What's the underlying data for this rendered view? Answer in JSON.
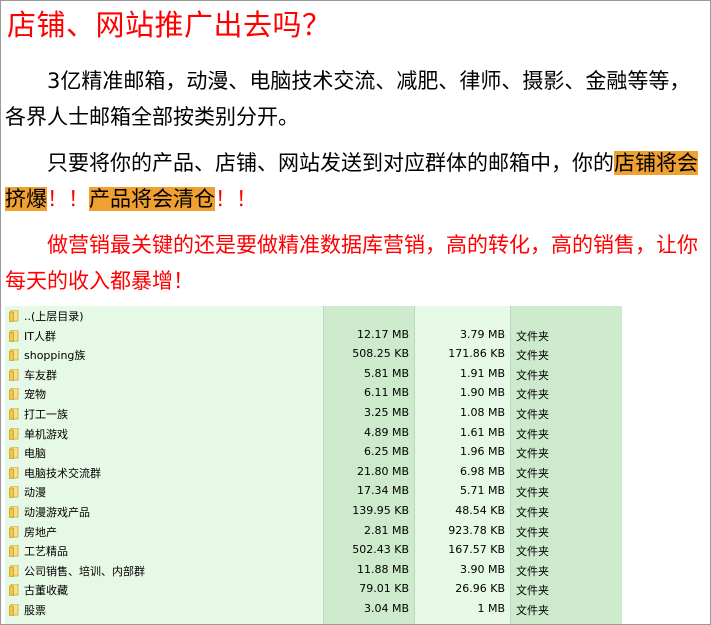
{
  "title": "店铺、网站推广出去吗？",
  "paragraph1": "3亿精准邮箱，动漫、电脑技术交流、减肥、律师、摄影、金融等等，各界人士邮箱全部按类别分开。",
  "paragraph2": {
    "lead": "只要将你的产品、店铺、网站发送到对应群体的邮箱中，你的",
    "hl1": "店铺将会挤爆",
    "mid": "！！",
    "hl2": "产品将会清仓",
    "tail": "！！"
  },
  "paragraph3": "做营销最关键的还是要做精准数据库营销，高的转化，高的销售，让你每天的收入都暴增！",
  "listing": {
    "parent": {
      "name": "..(上层目录)"
    },
    "rows": [
      {
        "name": "IT人群",
        "size": "12.17 MB",
        "compressed": "3.79 MB",
        "type": "文件夹"
      },
      {
        "name": "shopping族",
        "size": "508.25 KB",
        "compressed": "171.86 KB",
        "type": "文件夹"
      },
      {
        "name": "车友群",
        "size": "5.81 MB",
        "compressed": "1.91 MB",
        "type": "文件夹"
      },
      {
        "name": "宠物",
        "size": "6.11 MB",
        "compressed": "1.90 MB",
        "type": "文件夹"
      },
      {
        "name": "打工一族",
        "size": "3.25 MB",
        "compressed": "1.08 MB",
        "type": "文件夹"
      },
      {
        "name": "单机游戏",
        "size": "4.89 MB",
        "compressed": "1.61 MB",
        "type": "文件夹"
      },
      {
        "name": "电脑",
        "size": "6.25 MB",
        "compressed": "1.96 MB",
        "type": "文件夹"
      },
      {
        "name": "电脑技术交流群",
        "size": "21.80 MB",
        "compressed": "6.98 MB",
        "type": "文件夹"
      },
      {
        "name": "动漫",
        "size": "17.34 MB",
        "compressed": "5.71 MB",
        "type": "文件夹"
      },
      {
        "name": "动漫游戏产品",
        "size": "139.95 KB",
        "compressed": "48.54 KB",
        "type": "文件夹"
      },
      {
        "name": "房地产",
        "size": "2.81 MB",
        "compressed": "923.78 KB",
        "type": "文件夹"
      },
      {
        "name": "工艺精品",
        "size": "502.43 KB",
        "compressed": "167.57 KB",
        "type": "文件夹"
      },
      {
        "name": "公司销售、培训、内部群",
        "size": "11.88 MB",
        "compressed": "3.90 MB",
        "type": "文件夹"
      },
      {
        "name": "古董收藏",
        "size": "79.01 KB",
        "compressed": "26.96 KB",
        "type": "文件夹"
      },
      {
        "name": "股票",
        "size": "3.04 MB",
        "compressed": "1 MB",
        "type": "文件夹"
      }
    ]
  },
  "colors": {
    "title": "#ff0000",
    "highlight": "#f0a030",
    "list_bg": "#e6f8e6",
    "list_col_bg": "#cdeacd",
    "folder": "#f2c744"
  },
  "icons": {
    "folder": "folder-icon"
  }
}
